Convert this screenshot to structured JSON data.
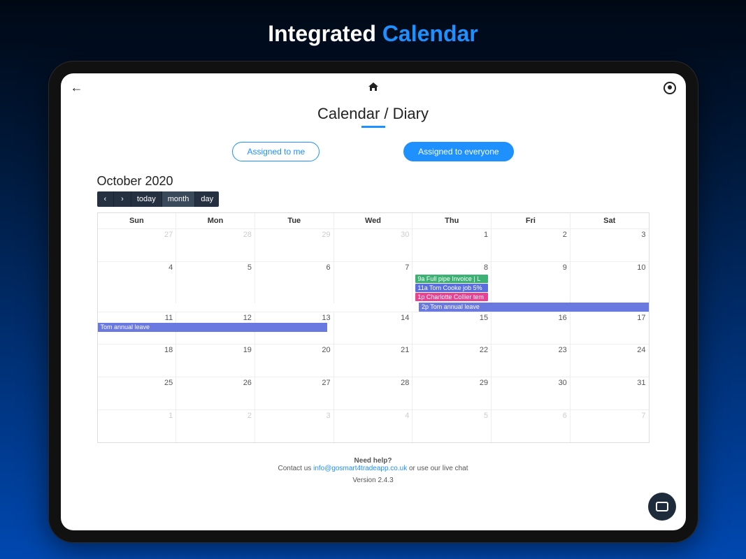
{
  "hero": {
    "title_part1": "Integrated ",
    "title_part2": "Calendar"
  },
  "page": {
    "title": "Calendar / Diary"
  },
  "filters": {
    "assigned_to_me": "Assigned to me",
    "assigned_to_everyone": "Assigned to everyone"
  },
  "calendar": {
    "month_label": "October 2020",
    "toolbar": {
      "prev": "‹",
      "next": "›",
      "today": "today",
      "month": "month",
      "day": "day"
    },
    "dow": [
      "Sun",
      "Mon",
      "Tue",
      "Wed",
      "Thu",
      "Fri",
      "Sat"
    ],
    "weeks": [
      [
        {
          "n": "27",
          "cls": "prev-month"
        },
        {
          "n": "28",
          "cls": "prev-month"
        },
        {
          "n": "29",
          "cls": "prev-month"
        },
        {
          "n": "30",
          "cls": "prev-month"
        },
        {
          "n": "1"
        },
        {
          "n": "2"
        },
        {
          "n": "3"
        }
      ],
      [
        {
          "n": "4"
        },
        {
          "n": "5"
        },
        {
          "n": "6"
        },
        {
          "n": "7"
        },
        {
          "n": "8"
        },
        {
          "n": "9"
        },
        {
          "n": "10"
        }
      ],
      [
        {
          "n": "11"
        },
        {
          "n": "12"
        },
        {
          "n": "13"
        },
        {
          "n": "14"
        },
        {
          "n": "15"
        },
        {
          "n": "16"
        },
        {
          "n": "17"
        }
      ],
      [
        {
          "n": "18"
        },
        {
          "n": "19"
        },
        {
          "n": "20"
        },
        {
          "n": "21"
        },
        {
          "n": "22"
        },
        {
          "n": "23"
        },
        {
          "n": "24"
        }
      ],
      [
        {
          "n": "25"
        },
        {
          "n": "26"
        },
        {
          "n": "27"
        },
        {
          "n": "28"
        },
        {
          "n": "29"
        },
        {
          "n": "30"
        },
        {
          "n": "31"
        }
      ],
      [
        {
          "n": "1",
          "cls": "next-month"
        },
        {
          "n": "2",
          "cls": "next-month"
        },
        {
          "n": "3",
          "cls": "next-month"
        },
        {
          "n": "4",
          "cls": "next-month"
        },
        {
          "n": "5",
          "cls": "next-month"
        },
        {
          "n": "6",
          "cls": "next-month"
        },
        {
          "n": "7",
          "cls": "next-month"
        }
      ]
    ],
    "events_thu8": [
      {
        "label": "9a Full pipe Invoice | L",
        "color": "ev-green"
      },
      {
        "label": "11a Tom Cooke job 5%",
        "color": "ev-blue"
      },
      {
        "label": "1p Charlotte Collier tem",
        "color": "ev-pink"
      }
    ],
    "span_event_8_10": "2p Tom annual leave",
    "span_event_11_13": "Tom annual leave"
  },
  "footer": {
    "need_help": "Need help?",
    "contact_pre": "Contact us ",
    "contact_link": "info@gosmart4tradeapp.co.uk",
    "contact_post": " or use our live chat",
    "version": "Version 2.4.3"
  }
}
